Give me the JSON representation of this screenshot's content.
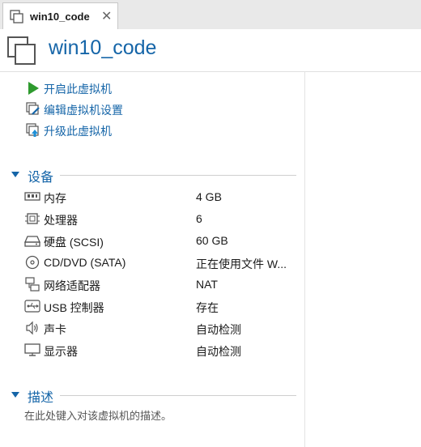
{
  "tab": {
    "label": "win10_code",
    "close": "✕"
  },
  "header": {
    "title": "win10_code"
  },
  "actions": [
    {
      "label": "开启此虚拟机",
      "icon": "play-icon"
    },
    {
      "label": "编辑虚拟机设置",
      "icon": "edit-settings-icon"
    },
    {
      "label": "升级此虚拟机",
      "icon": "upgrade-icon"
    }
  ],
  "devices_section": {
    "title": "设备"
  },
  "devices": [
    {
      "name": "内存",
      "value": "4 GB",
      "icon": "memory-icon"
    },
    {
      "name": "处理器",
      "value": "6",
      "icon": "processor-icon"
    },
    {
      "name": "硬盘 (SCSI)",
      "value": "60 GB",
      "icon": "hard-disk-icon"
    },
    {
      "name": "CD/DVD (SATA)",
      "value": "正在使用文件 W...",
      "icon": "cd-dvd-icon"
    },
    {
      "name": "网络适配器",
      "value": "NAT",
      "icon": "network-adapter-icon"
    },
    {
      "name": "USB 控制器",
      "value": "存在",
      "icon": "usb-icon"
    },
    {
      "name": "声卡",
      "value": "自动检测",
      "icon": "sound-card-icon"
    },
    {
      "name": "显示器",
      "value": "自动检测",
      "icon": "display-icon"
    }
  ],
  "description_section": {
    "title": "描述",
    "placeholder": "在此处键入对该虚拟机的描述。"
  },
  "colors": {
    "accent": "#1565a8",
    "play_green": "#2e9a2e"
  }
}
